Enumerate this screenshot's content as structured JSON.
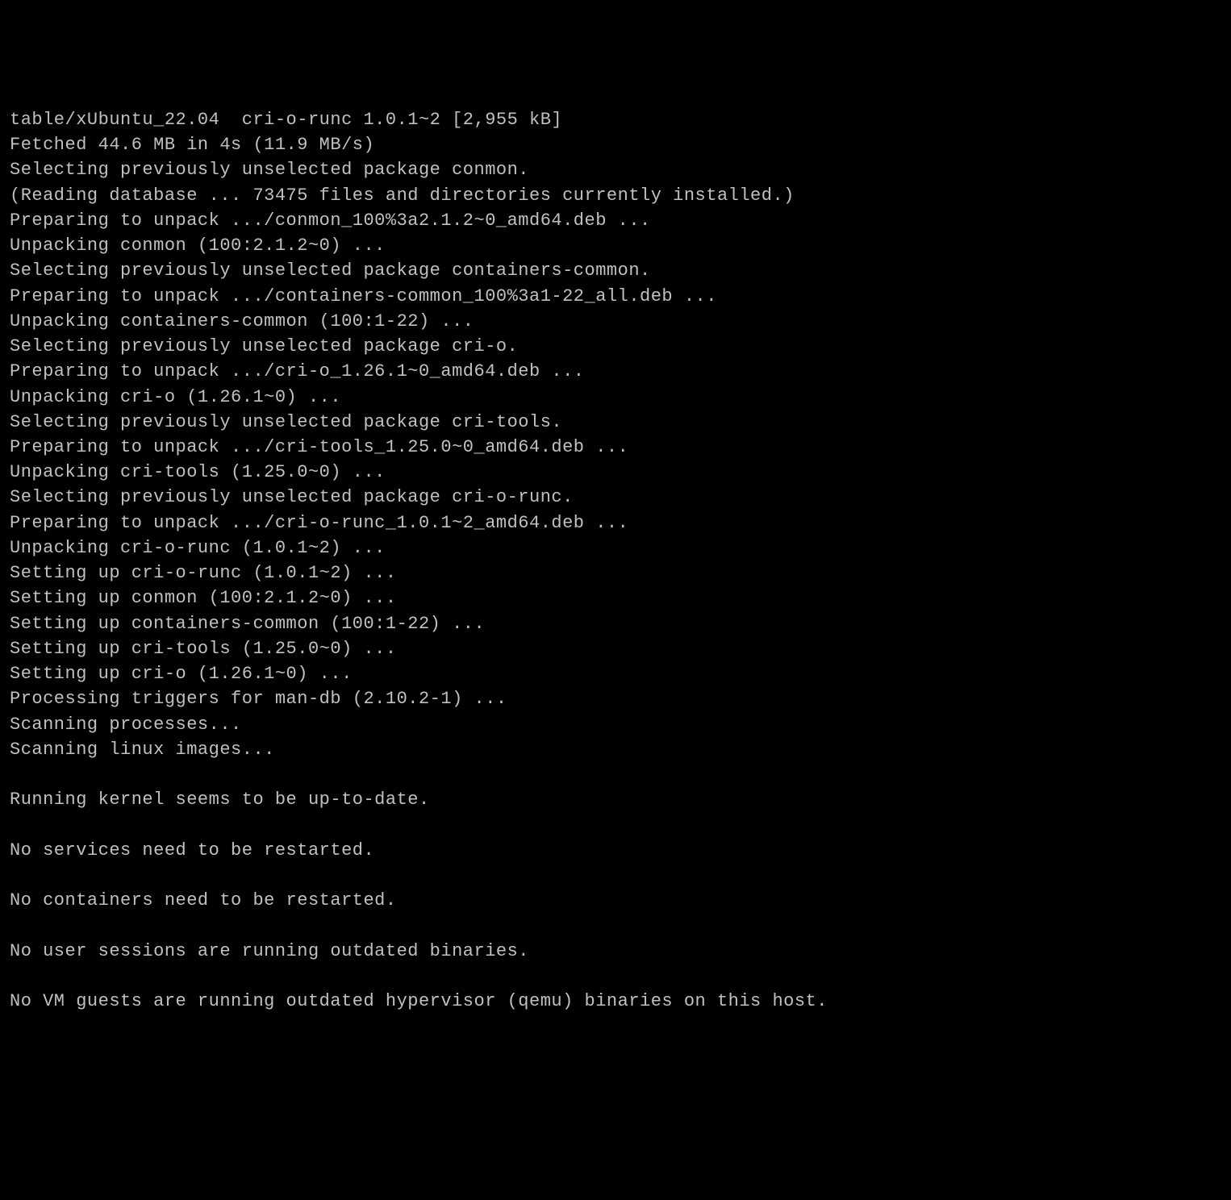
{
  "terminal": {
    "lines": [
      "table/xUbuntu_22.04  cri-o-runc 1.0.1~2 [2,955 kB]",
      "Fetched 44.6 MB in 4s (11.9 MB/s)",
      "Selecting previously unselected package conmon.",
      "(Reading database ... 73475 files and directories currently installed.)",
      "Preparing to unpack .../conmon_100%3a2.1.2~0_amd64.deb ...",
      "Unpacking conmon (100:2.1.2~0) ...",
      "Selecting previously unselected package containers-common.",
      "Preparing to unpack .../containers-common_100%3a1-22_all.deb ...",
      "Unpacking containers-common (100:1-22) ...",
      "Selecting previously unselected package cri-o.",
      "Preparing to unpack .../cri-o_1.26.1~0_amd64.deb ...",
      "Unpacking cri-o (1.26.1~0) ...",
      "Selecting previously unselected package cri-tools.",
      "Preparing to unpack .../cri-tools_1.25.0~0_amd64.deb ...",
      "Unpacking cri-tools (1.25.0~0) ...",
      "Selecting previously unselected package cri-o-runc.",
      "Preparing to unpack .../cri-o-runc_1.0.1~2_amd64.deb ...",
      "Unpacking cri-o-runc (1.0.1~2) ...",
      "Setting up cri-o-runc (1.0.1~2) ...",
      "Setting up conmon (100:2.1.2~0) ...",
      "Setting up containers-common (100:1-22) ...",
      "Setting up cri-tools (1.25.0~0) ...",
      "Setting up cri-o (1.26.1~0) ...",
      "Processing triggers for man-db (2.10.2-1) ...",
      "Scanning processes...",
      "Scanning linux images...",
      "",
      "Running kernel seems to be up-to-date.",
      "",
      "No services need to be restarted.",
      "",
      "No containers need to be restarted.",
      "",
      "No user sessions are running outdated binaries.",
      "",
      "No VM guests are running outdated hypervisor (qemu) binaries on this host."
    ]
  }
}
